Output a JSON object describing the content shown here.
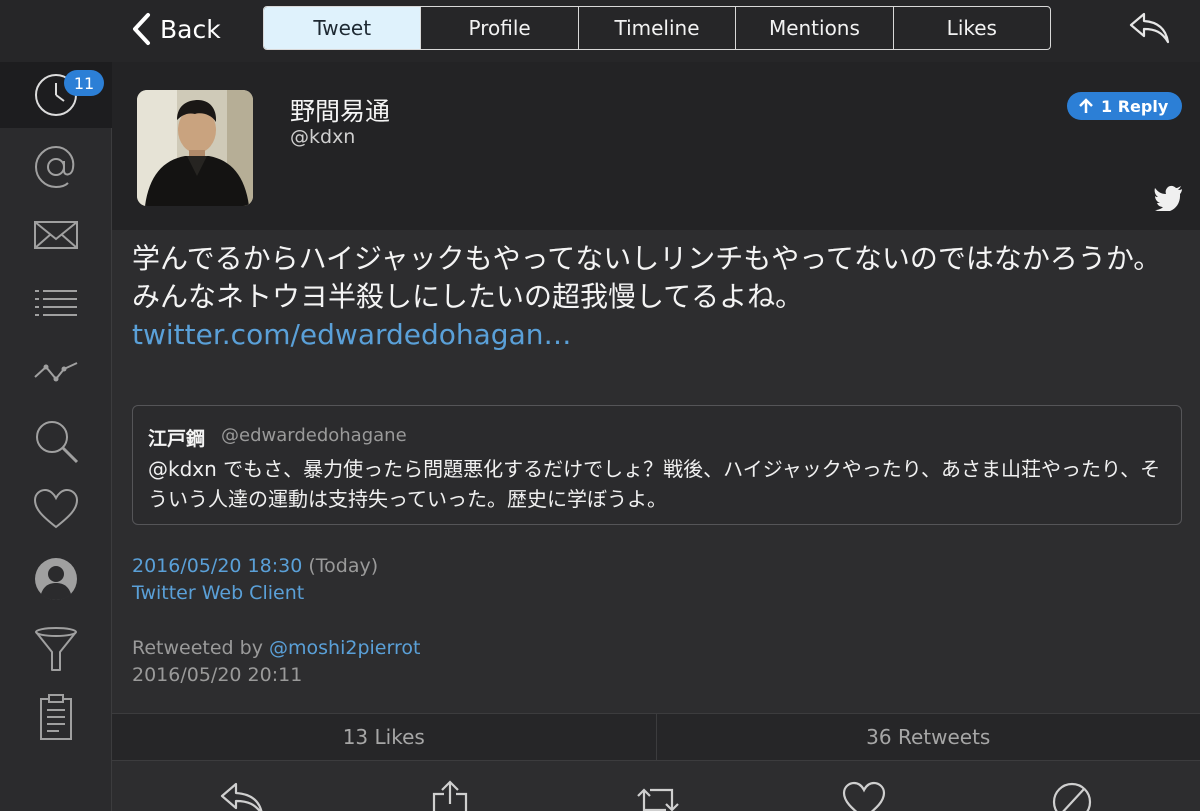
{
  "nav": {
    "back_label": "Back",
    "tabs": [
      {
        "label": "Tweet",
        "active": true
      },
      {
        "label": "Profile",
        "active": false
      },
      {
        "label": "Timeline",
        "active": false
      },
      {
        "label": "Mentions",
        "active": false
      },
      {
        "label": "Likes",
        "active": false
      }
    ]
  },
  "sidebar": {
    "items": [
      {
        "icon": "clock-icon",
        "badge": "11",
        "active": true
      },
      {
        "icon": "at-icon"
      },
      {
        "icon": "envelope-icon"
      },
      {
        "icon": "list-icon"
      },
      {
        "icon": "activity-icon"
      },
      {
        "icon": "search-icon"
      },
      {
        "icon": "heart-icon"
      },
      {
        "icon": "user-icon"
      },
      {
        "icon": "filter-icon"
      },
      {
        "icon": "clipboard-icon"
      }
    ]
  },
  "tweet": {
    "user_name": "野間易通",
    "user_handle": "@kdxn",
    "reply_count_label": "1 Reply",
    "text": "学んでるからハイジャックもやってないしリンチもやってないのではなかろうか。みんなネトウヨ半殺しにしたいの超我慢してるよね。 ",
    "link": "twitter.com/edwardedohagan…",
    "quote": {
      "name": "江戸鋼",
      "handle": "@edwardedohagane",
      "text": "@kdxn でもさ、暴力使ったら問題悪化するだけでしょ？戦後、ハイジャックやったり、あさま山荘やったり、そういう人達の運動は支持失っていった。歴史に学ぼうよ。"
    },
    "datetime": "2016/05/20 18:30",
    "datetime_note": " (Today)",
    "client": "Twitter Web Client",
    "retweeted_by_label": "Retweeted by ",
    "retweeted_by_user": "@moshi2pierrot",
    "retweet_datetime": "2016/05/20 20:11"
  },
  "stats": {
    "likes_label": "13 Likes",
    "retweets_label": "36 Retweets"
  },
  "colors": {
    "accent": "#2c7fd6",
    "link": "#5aa0d8",
    "background": "#2d2d2f",
    "active_tab": "#dff2fc"
  }
}
